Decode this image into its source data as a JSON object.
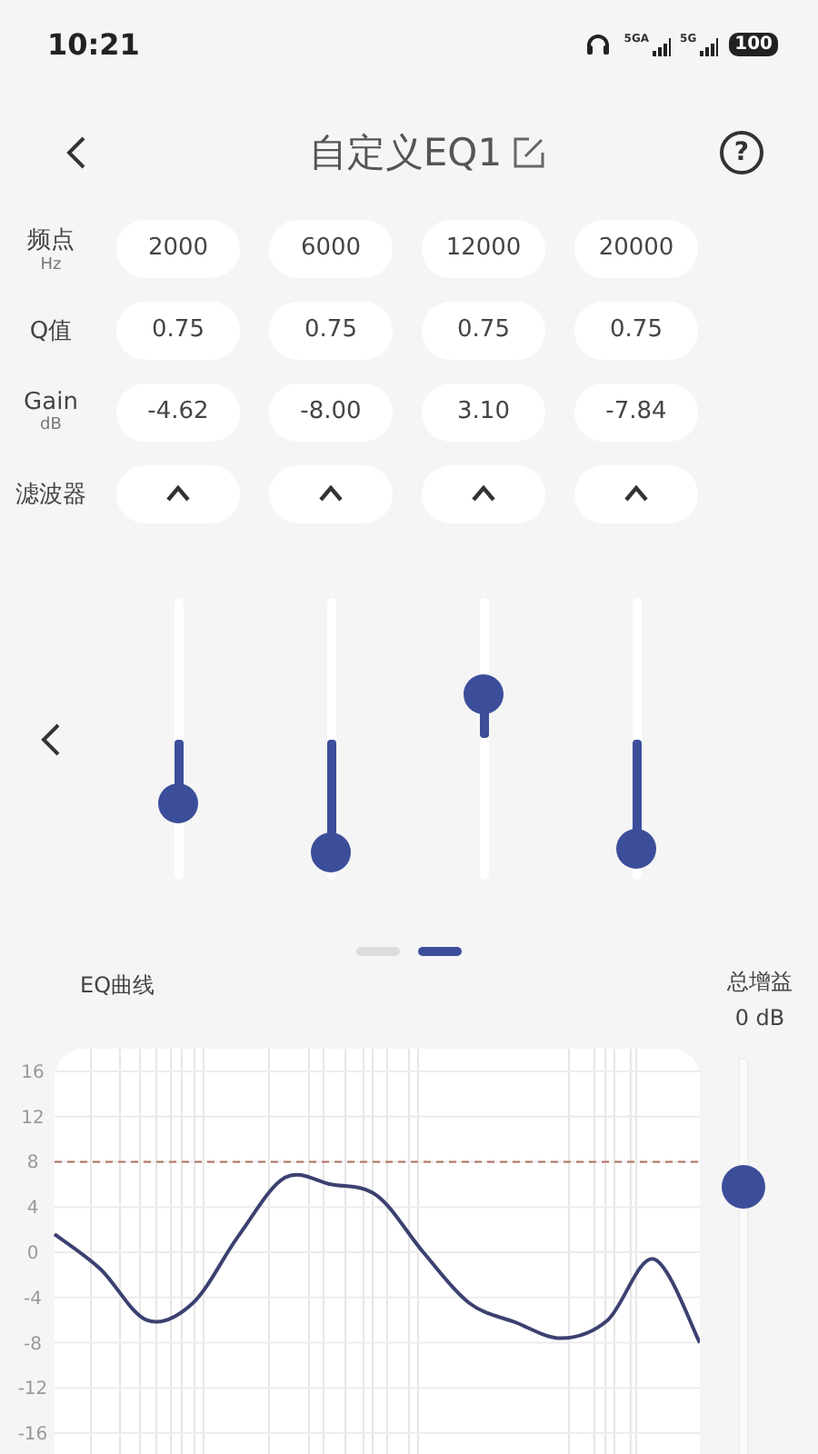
{
  "status_bar": {
    "time": "10:21",
    "network_1": "5GA",
    "network_2": "5G",
    "battery": "100"
  },
  "header": {
    "title": "自定义EQ1",
    "help": "?"
  },
  "bands": [
    {
      "kind": "text",
      "label": "频点",
      "unit": "Hz",
      "values": [
        "2000",
        "6000",
        "12000",
        "20000"
      ]
    },
    {
      "kind": "text",
      "label": "Q值",
      "values": [
        "0.75",
        "0.75",
        "0.75",
        "0.75"
      ]
    },
    {
      "kind": "text",
      "label": "Gain",
      "unit": "dB",
      "values": [
        "-4.62",
        "-8.00",
        "3.10",
        "-7.84"
      ]
    },
    {
      "kind": "filter",
      "label": "滤波器",
      "filters": [
        {
          "kind": "peak"
        },
        {
          "kind": "peak"
        },
        {
          "kind": "peak"
        },
        {
          "kind": "peak"
        }
      ]
    }
  ],
  "sliders": [
    {
      "level": 0.269
    },
    {
      "level": 0.1
    },
    {
      "level": 0.655
    },
    {
      "level": 0.108
    }
  ],
  "pager": [
    {
      "selected": false
    },
    {
      "selected": true
    }
  ],
  "curve": {
    "label": "EQ曲线",
    "chart_data": {
      "type": "line",
      "ylim": [
        -18,
        18
      ],
      "yticks": [
        16,
        12,
        8,
        4,
        0,
        -4,
        -8,
        -12,
        -16
      ],
      "grid": true,
      "series": [
        {
          "color": "#3b4170",
          "values": [
            1.6,
            -1.5,
            -6,
            -4.5,
            1.5,
            6.6,
            6,
            5,
            0,
            -4.5,
            -6.2,
            -7.6,
            -6,
            -0.6,
            -8
          ]
        }
      ],
      "ref_lines": [
        {
          "axis": "y",
          "value": 8,
          "color": "#b07060"
        }
      ]
    }
  },
  "master_gain": {
    "label": "总增益",
    "reading": "0 dB",
    "level": 0.68
  }
}
